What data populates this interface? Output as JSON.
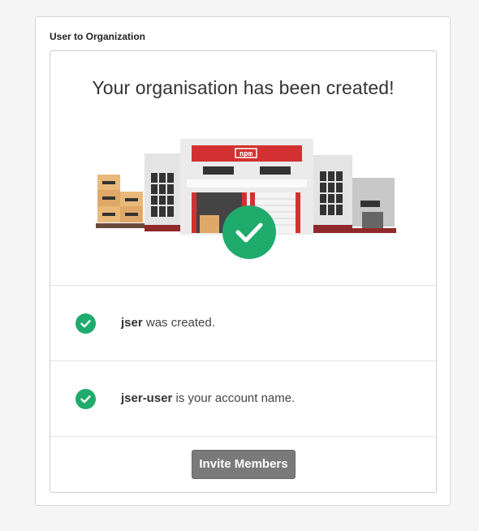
{
  "panel": {
    "title": "User to Organization"
  },
  "hero": {
    "title": "Your organisation has been created!",
    "sign_text": "npm",
    "box_label": "npm"
  },
  "messages": [
    {
      "bold": "jser",
      "text": " was created."
    },
    {
      "bold": "jser-user",
      "text": " is your account name."
    }
  ],
  "actions": {
    "invite_label": "Invite Members"
  },
  "colors": {
    "success": "#1fab6c",
    "npm_red": "#d33131",
    "button": "#7a7a7a"
  }
}
